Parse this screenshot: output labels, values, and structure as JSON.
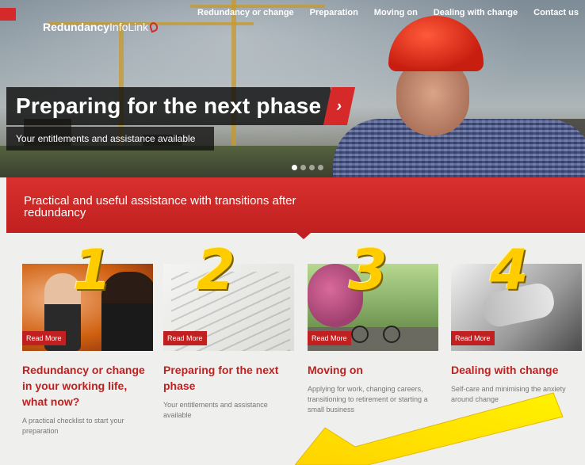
{
  "site": {
    "logo_bold": "Redundancy",
    "logo_light": "InfoLink"
  },
  "nav": [
    {
      "label": "Redundancy or change"
    },
    {
      "label": "Preparation"
    },
    {
      "label": "Moving on"
    },
    {
      "label": "Dealing with change"
    },
    {
      "label": "Contact us"
    }
  ],
  "hero": {
    "headline": "Preparing for the next phase",
    "arrow": "›",
    "subline": "Your entitlements and assistance available",
    "slide_count": 4,
    "active_slide": 1
  },
  "band": {
    "text": "Practical and useful assistance with transitions after redundancy"
  },
  "annotations": {
    "numbers": [
      "1",
      "2",
      "3",
      "4"
    ],
    "highlight_color": "#ffcc00"
  },
  "cards": [
    {
      "read_more": "Read More",
      "title": "Redundancy or change in your working life, what now?",
      "desc": "A practical checklist to start your preparation"
    },
    {
      "read_more": "Read More",
      "title": "Preparing for the next phase",
      "desc": "Your entitlements and assistance available"
    },
    {
      "read_more": "Read More",
      "title": "Moving on",
      "desc": "Applying for work, changing careers, transitioning to retirement or starting a small business"
    },
    {
      "read_more": "Read More",
      "title": "Dealing with change",
      "desc": "Self-care and minimising the anxiety around change"
    }
  ],
  "colors": {
    "brand_red": "#c0201f",
    "accent_red": "#d62a2a",
    "background": "#efefed"
  }
}
